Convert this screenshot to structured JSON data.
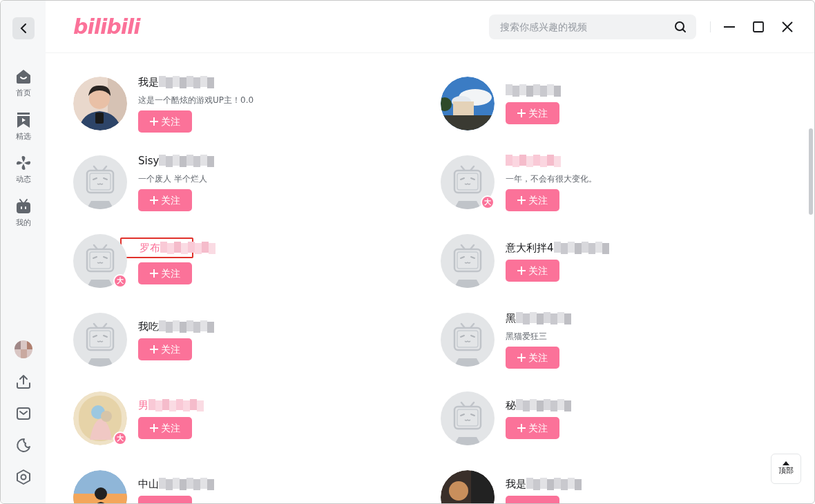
{
  "header": {
    "logo": "bilibili",
    "search": {
      "placeholder": "搜索你感兴趣的视频"
    }
  },
  "sidebar": {
    "items": [
      {
        "label": "首页",
        "kind": "home",
        "selected": false
      },
      {
        "label": "精选",
        "kind": "featured",
        "selected": false
      },
      {
        "label": "动态",
        "kind": "pinwheel",
        "selected": false
      },
      {
        "label": "我的",
        "kind": "tv",
        "selected": false
      }
    ],
    "bottom_icons": [
      {
        "kind": "avatar"
      },
      {
        "kind": "upload"
      },
      {
        "kind": "mail"
      },
      {
        "kind": "moon"
      },
      {
        "kind": "settings"
      }
    ]
  },
  "columns": [
    [
      {
        "name": "我是",
        "redacted": true,
        "vip": false,
        "bio": "这是一个酷炫的游戏UP主！0.0",
        "kind": "picture",
        "highlighted": false,
        "button": "关注"
      },
      {
        "name": "Sisy",
        "redacted": true,
        "vip": false,
        "bio": "一个废人 半个烂人",
        "kind": "default",
        "highlighted": false,
        "button": "关注"
      },
      {
        "name": "罗布",
        "redacted": true,
        "vip": true,
        "kind": "default",
        "badge": "大",
        "highlighted": true,
        "button": "关注"
      },
      {
        "name": "我吃",
        "redacted": true,
        "vip": false,
        "kind": "default",
        "highlighted": false,
        "button": "关注"
      },
      {
        "name": "男",
        "redacted": true,
        "vip": true,
        "kind": "picture",
        "badge": "大",
        "highlighted": false,
        "button": "关注"
      },
      {
        "name": "中山",
        "redacted": true,
        "vip": false,
        "kind": "picture",
        "highlighted": false
      }
    ],
    [
      {
        "redacted": true,
        "vip": false,
        "kind": "picture",
        "highlighted": false,
        "button": "关注"
      },
      {
        "redacted": true,
        "vip": true,
        "bio": "一年，不会有很大变化。",
        "kind": "default",
        "badge": "大",
        "highlighted": false,
        "button": "关注"
      },
      {
        "name": "意大利拌4",
        "redacted": true,
        "vip": false,
        "kind": "default",
        "highlighted": false,
        "button": "关注"
      },
      {
        "name": "黑",
        "redacted": true,
        "vip": false,
        "bio": "黑猫爱狂三",
        "kind": "default",
        "highlighted": false,
        "button": "关注"
      },
      {
        "name": "秘",
        "redacted": true,
        "vip": false,
        "kind": "default",
        "highlighted": false,
        "button": "关注"
      },
      {
        "name": "我是",
        "redacted": true,
        "vip": false,
        "kind": "picture",
        "highlighted": false
      }
    ]
  ],
  "back_to_top": "顶部"
}
